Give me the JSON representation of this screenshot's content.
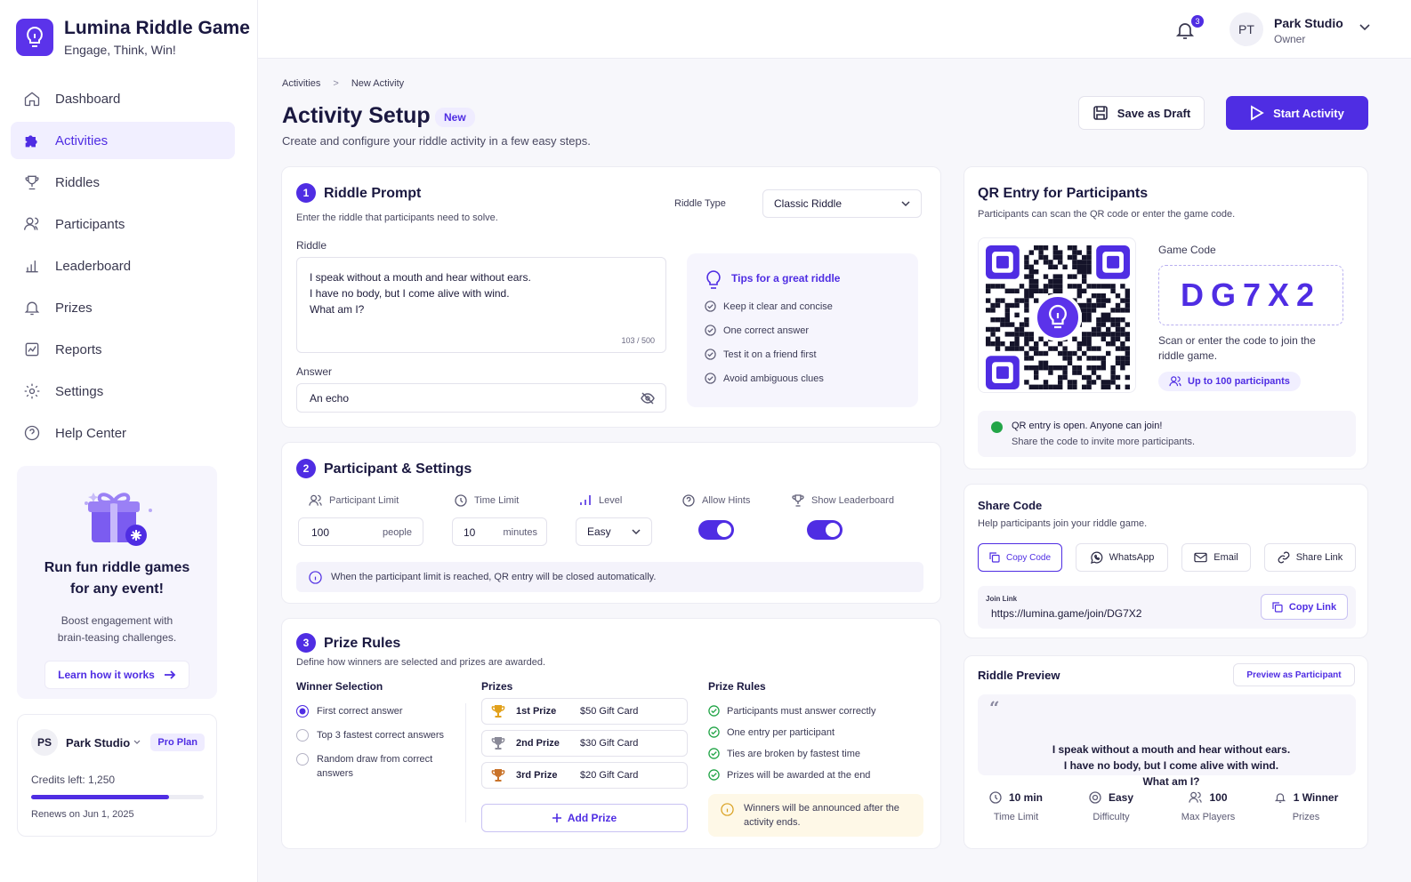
{
  "brand": {
    "title": "Lumina Riddle Game",
    "tagline": "Engage, Think, Win!"
  },
  "nav": [
    {
      "label": "Dashboard",
      "icon": "home-icon"
    },
    {
      "label": "Activities",
      "icon": "puzzle-icon",
      "active": true
    },
    {
      "label": "Riddles",
      "icon": "trophy-icon"
    },
    {
      "label": "Participants",
      "icon": "users-icon"
    },
    {
      "label": "Leaderboard",
      "icon": "bar-chart-icon"
    },
    {
      "label": "Prizes",
      "icon": "bell-icon"
    },
    {
      "label": "Reports",
      "icon": "report-icon"
    },
    {
      "label": "Settings",
      "icon": "gear-icon"
    },
    {
      "label": "Help Center",
      "icon": "help-icon"
    }
  ],
  "promo": {
    "title": "Run fun riddle games for any event!",
    "desc": "Boost engagement with brain-teasing challenges.",
    "cta": "Learn how it works"
  },
  "account": {
    "initials": "PS",
    "name": "Park Studio",
    "plan": "Pro Plan",
    "credits": "Credits left: 1,250",
    "credit_progress": 0.8,
    "renews": "Renews on Jun 1, 2025"
  },
  "topbar": {
    "notifications": "3",
    "user_initials": "PT",
    "user_name": "Park Studio",
    "user_role": "Owner"
  },
  "header": {
    "crumb_1": "Activities",
    "crumb_sep": ">",
    "crumb_2": "New Activity",
    "title": "Activity Setup",
    "badge": "New",
    "subtitle": "Create and configure your riddle activity in a few easy steps.",
    "save_draft": "Save as Draft",
    "start": "Start Activity"
  },
  "step1": {
    "num": "1",
    "title": "Riddle Prompt",
    "subtitle": "Enter the riddle that participants need to solve.",
    "type_label": "Riddle Type",
    "type_value": "Classic Riddle",
    "riddle_label": "Riddle",
    "riddle_text": "I speak without a mouth and hear without ears.\nI have no body, but I come alive with wind.\nWhat am I?",
    "char_count": "103 / 500",
    "answer_label": "Answer",
    "answer_value": "An echo",
    "tips_title": "Tips for a great riddle",
    "tips": [
      "Keep it clear and concise",
      "One correct answer",
      "Test it on a friend first",
      "Avoid ambiguous clues"
    ]
  },
  "step2": {
    "num": "2",
    "title": "Participant & Settings",
    "participant_label": "Participant Limit",
    "participant_value": "100",
    "participant_unit": "people",
    "time_label": "Time Limit",
    "time_value": "10",
    "time_unit": "minutes",
    "level_label": "Level",
    "level_value": "Easy",
    "hints_label": "Allow Hints",
    "leaderboard_label": "Show Leaderboard",
    "info": "When the participant limit is reached, QR entry will be closed automatically."
  },
  "step3": {
    "num": "3",
    "title": "Prize Rules",
    "subtitle": "Define how winners are selected and prizes are awarded.",
    "winner_head": "Winner Selection",
    "winner_options": [
      "First correct answer",
      "Top 3 fastest correct answers",
      "Random draw from correct answers"
    ],
    "prizes_head": "Prizes",
    "prizes": [
      {
        "place": "1st Prize",
        "reward": "$50 Gift Card",
        "color": "#e2a11b"
      },
      {
        "place": "2nd Prize",
        "reward": "$30 Gift Card",
        "color": "#8a8a98"
      },
      {
        "place": "3rd Prize",
        "reward": "$20 Gift Card",
        "color": "#c9732a"
      }
    ],
    "add_prize": "Add Prize",
    "rules_head": "Prize Rules",
    "rules": [
      "Participants must answer correctly",
      "One entry per participant",
      "Ties are broken by fastest time",
      "Prizes will be awarded at the end"
    ],
    "announce": "Winners will be announced after the activity ends."
  },
  "qr": {
    "title": "QR Entry for Participants",
    "subtitle": "Participants can scan the QR code or enter the game code.",
    "code_label": "Game Code",
    "code": "DG7X2",
    "code_desc": "Scan or enter the code to join the riddle game.",
    "limit_chip": "Up to 100 participants",
    "open_title": "QR entry is open. Anyone can join!",
    "open_desc": "Share the code to invite more participants."
  },
  "share": {
    "title": "Share Code",
    "subtitle": "Help participants join your riddle game.",
    "buttons": [
      "Copy Code",
      "WhatsApp",
      "Email",
      "Share Link"
    ],
    "link_label": "Join Link",
    "link": "https://lumina.game/join/DG7X2",
    "copy_link": "Copy Link"
  },
  "preview": {
    "title": "Riddle Preview",
    "button": "Preview as Participant",
    "quote_mark": "“",
    "text": "I speak without a mouth and hear without ears.\nI have no body, but I come alive with wind.\nWhat am I?",
    "stats": [
      {
        "value": "10 min",
        "label": "Time Limit"
      },
      {
        "value": "Easy",
        "label": "Difficulty"
      },
      {
        "value": "100",
        "label": "Max Players"
      },
      {
        "value": "1 Winner",
        "label": "Prizes"
      }
    ]
  },
  "colors": {
    "accent": "#4f2de3",
    "success": "#23a548",
    "warning_bg": "#fef8e7"
  }
}
